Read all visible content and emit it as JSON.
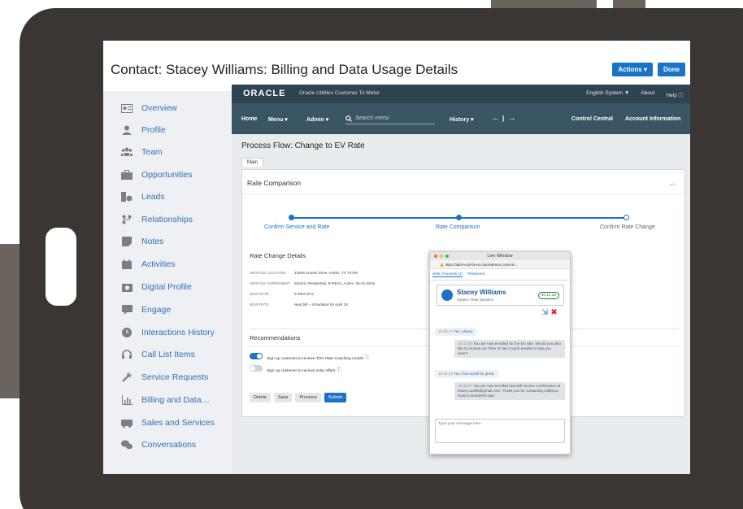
{
  "page": {
    "title": "Contact: Stacey Williams: Billing and Data Usage Details",
    "actions_label": "Actions ▾",
    "done_label": "Done"
  },
  "nav": {
    "items": [
      {
        "label": "Overview",
        "icon": "id-card-icon"
      },
      {
        "label": "Profile",
        "icon": "person-icon"
      },
      {
        "label": "Team",
        "icon": "team-icon"
      },
      {
        "label": "Opportunities",
        "icon": "briefcase-icon"
      },
      {
        "label": "Leads",
        "icon": "leads-icon"
      },
      {
        "label": "Relationships",
        "icon": "relationships-icon"
      },
      {
        "label": "Notes",
        "icon": "notes-icon"
      },
      {
        "label": "Activities",
        "icon": "calendar-icon"
      },
      {
        "label": "Digital Profile",
        "icon": "camera-icon"
      },
      {
        "label": "Engage",
        "icon": "chat-icon"
      },
      {
        "label": "Interactions History",
        "icon": "clock-icon"
      },
      {
        "label": "Call List Items",
        "icon": "headset-icon"
      },
      {
        "label": "Service Requests",
        "icon": "wrench-icon"
      },
      {
        "label": "Billing and Data…",
        "icon": "bar-chart-icon"
      },
      {
        "label": "Sales and Services",
        "icon": "truck-icon"
      },
      {
        "label": "Conversations",
        "icon": "conversation-icon"
      }
    ],
    "active_index": 13
  },
  "oracle": {
    "logo": "ORACLE",
    "product": "Oracle Utilities Customer To Meter",
    "language": "English System ▼",
    "about": "About",
    "help": "Help ⓘ"
  },
  "menu": {
    "home": "Home",
    "menu": "Menu ▾",
    "admin": "Admin ▾",
    "search_placeholder": "Search menu",
    "history": "History ▾",
    "control_central": "Control Central",
    "account_information": "Account Information"
  },
  "process": {
    "title": "Process Flow: Change to EV Rate",
    "tab": "Main",
    "card_title": "Rate Comparison",
    "steps": [
      "Confirm Service and Rate",
      "Rate Comparison",
      "Confirm Rate Change"
    ]
  },
  "details": {
    "title": "Rate Change Details",
    "rows": [
      {
        "key": "SERVICE LOCATION",
        "value": "12606 Sunset Drive, Austin, TX 78748"
      },
      {
        "key": "SERVICE AGREEMENT",
        "value": "Electric Residential, E-RES1, Active, 06-01-2016"
      },
      {
        "key": "NEW RATE",
        "value": "E-RES-EV1"
      },
      {
        "key": "NEW RATE",
        "value": "Next bill – scheduled for April 19"
      }
    ]
  },
  "recommendations": {
    "title": "Recommendations",
    "items": [
      {
        "label": "Sign up customer to receive TOU Rate Coaching emails",
        "on": true
      },
      {
        "label": "Sign up customer to receive solar offers",
        "on": false
      }
    ]
  },
  "buttons": {
    "delete": "Delete",
    "save": "Save",
    "previous": "Previous",
    "submit": "Submit"
  },
  "live_window": {
    "title": "Live Window",
    "url": "https://adc5-ecjv-fa-ext.oracledemos.com/om...",
    "tabs": [
      "Web Channels (1)",
      "Telephone"
    ],
    "contact_name": "Stacey Williams",
    "subject": "Subject: Rate Question",
    "timer": "00:11:25",
    "messages": [
      {
        "dir": "in",
        "time": "15:30:17",
        "text": "Yes, please"
      },
      {
        "dir": "out",
        "time": "15:32:46",
        "text": "You are now enrolled for the EV rate. Would you also like to receive our Time of Use Coach emails to help you save?"
      },
      {
        "dir": "in",
        "time": "15:33:30",
        "text": "Yes, that would be great."
      },
      {
        "dir": "out",
        "time": "15:35:07",
        "text": "You are now enrolled and will receive confirmation at stacey.11606@gmail.com. Thank you for contacting UtilityCo. Have a wonderful day!"
      }
    ],
    "input_placeholder": "Type your message here"
  },
  "colors": {
    "frame": "#3b3633",
    "accent": "#1b73c7",
    "oracle_bar": "#2d4450",
    "menu_bar": "#3a5563"
  }
}
